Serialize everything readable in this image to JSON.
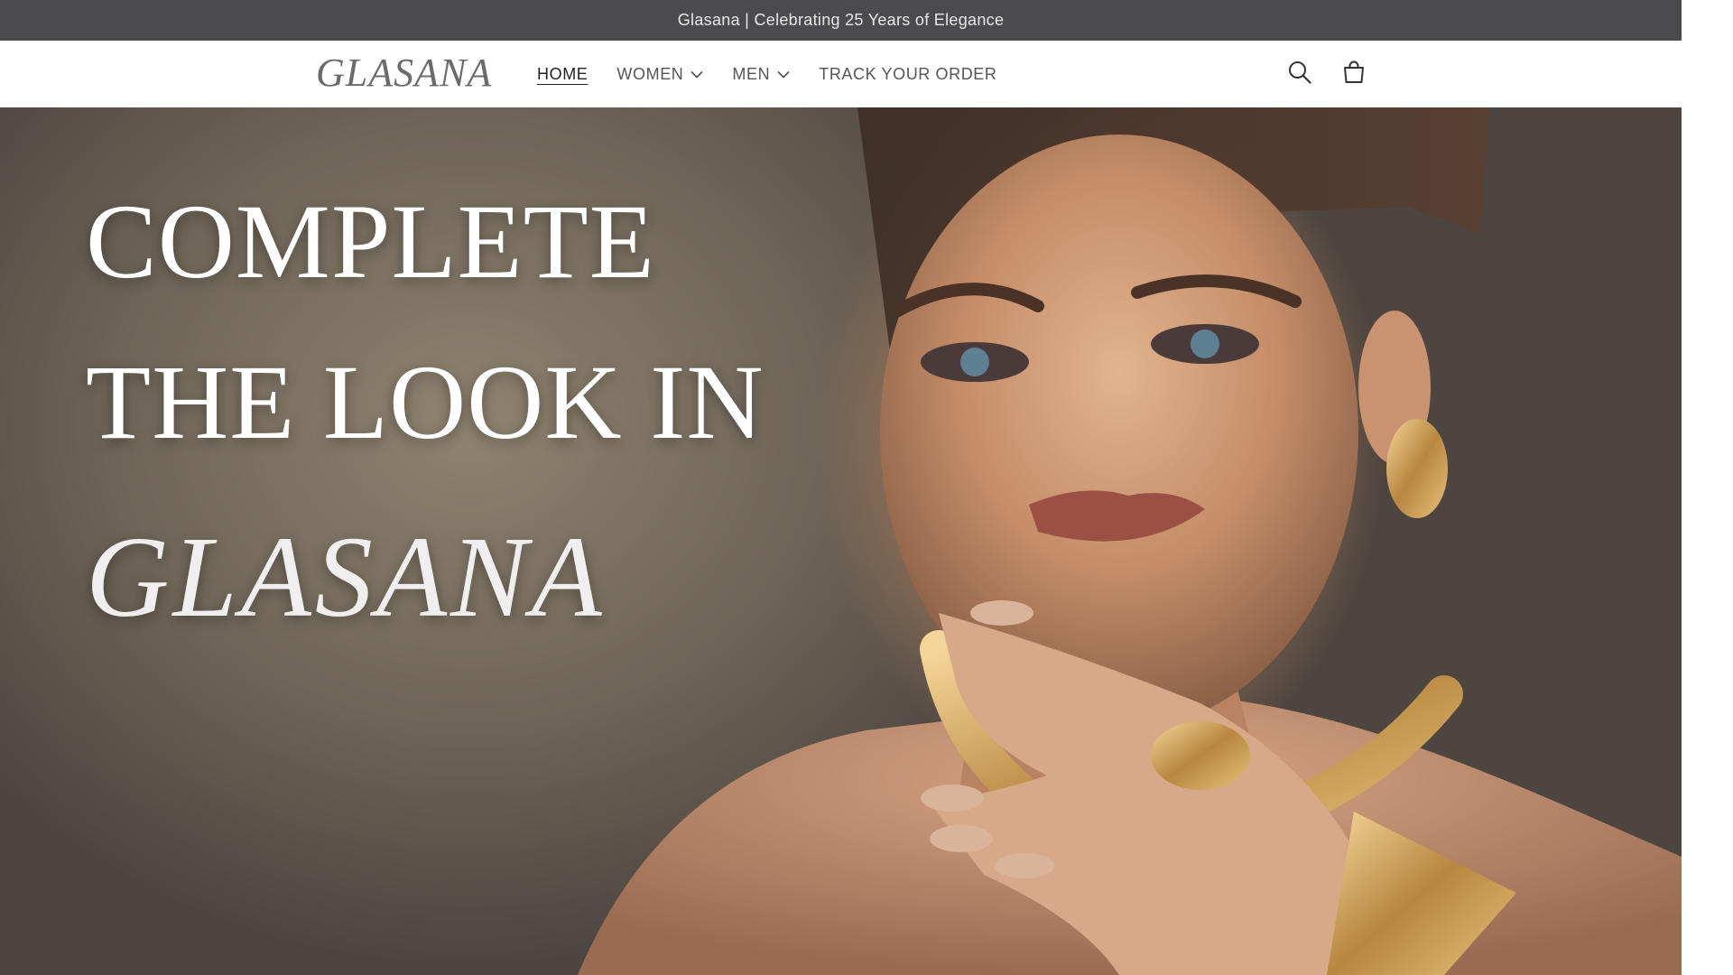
{
  "announcement": {
    "text": "Glasana | Celebrating 25 Years of Elegance"
  },
  "header": {
    "logo": "GLASANA",
    "nav": [
      {
        "label": "HOME",
        "active": true,
        "dropdown": false
      },
      {
        "label": "WOMEN",
        "active": false,
        "dropdown": true
      },
      {
        "label": "MEN",
        "active": false,
        "dropdown": true
      },
      {
        "label": "TRACK YOUR ORDER",
        "active": false,
        "dropdown": false
      }
    ],
    "icons": [
      "search-icon",
      "cart-icon"
    ]
  },
  "hero": {
    "line1": "COMPLETE",
    "line2": "THE LOOK IN",
    "line3": "GLASANA"
  },
  "colors": {
    "announcement_bg": "#4b4b4d",
    "text_white": "#ffffff",
    "nav_text": "#555555"
  }
}
